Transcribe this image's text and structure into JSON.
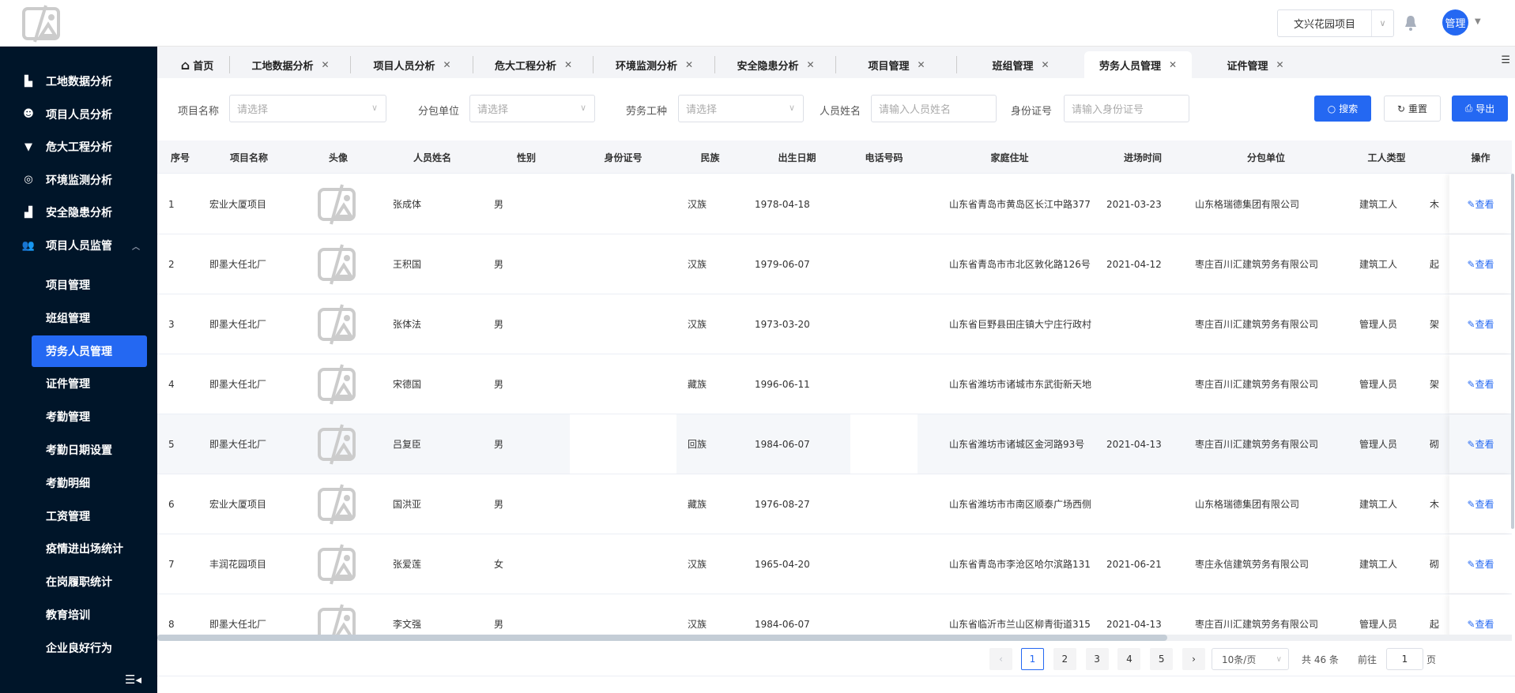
{
  "header": {
    "project_select": "文兴花园项目",
    "avatar_label": "管理"
  },
  "sidebar": {
    "items": [
      {
        "label": "工地数据分析",
        "icon": "building-icon"
      },
      {
        "label": "项目人员分析",
        "icon": "person-icon"
      },
      {
        "label": "危大工程分析",
        "icon": "filter-icon"
      },
      {
        "label": "环境监测分析",
        "icon": "globe-icon"
      },
      {
        "label": "安全隐患分析",
        "icon": "bar-chart-icon"
      },
      {
        "label": "项目人员监管",
        "icon": "users-icon"
      }
    ],
    "sub_items": [
      "项目管理",
      "班组管理",
      "劳务人员管理",
      "证件管理",
      "考勤管理",
      "考勤日期设置",
      "考勤明细",
      "工资管理",
      "疫情进出场统计",
      "在岗履职统计",
      "教育培训",
      "企业良好行为"
    ],
    "active_sub": "劳务人员管理"
  },
  "tabs": [
    {
      "label": "首页",
      "closable": false
    },
    {
      "label": "工地数据分析"
    },
    {
      "label": "项目人员分析"
    },
    {
      "label": "危大工程分析"
    },
    {
      "label": "环境监测分析"
    },
    {
      "label": "安全隐患分析"
    },
    {
      "label": "项目管理"
    },
    {
      "label": "班组管理"
    },
    {
      "label": "劳务人员管理",
      "active": true
    },
    {
      "label": "证件管理"
    }
  ],
  "filters": {
    "project_label": "项目名称",
    "project_placeholder": "请选择",
    "subcontractor_label": "分包单位",
    "subcontractor_placeholder": "请选择",
    "worktype_label": "劳务工种",
    "worktype_placeholder": "请选择",
    "name_label": "人员姓名",
    "name_placeholder": "请输入人员姓名",
    "id_label": "身份证号",
    "id_placeholder": "请输入身份证号",
    "search_button": "搜索",
    "reset_button": "重置",
    "export_button": "导出"
  },
  "table": {
    "columns": [
      "序号",
      "项目名称",
      "头像",
      "人员姓名",
      "性别",
      "身份证号",
      "民族",
      "出生日期",
      "电话号码",
      "家庭住址",
      "进场时间",
      "分包单位",
      "工人类型",
      "",
      "操作"
    ],
    "action_label": "查看",
    "rows": [
      {
        "seq": "1",
        "project": "宏业大厦项目",
        "name": "张成体",
        "gender": "男",
        "ethnic": "汉族",
        "birth": "1978-04-18",
        "address": "山东省青岛市黄岛区长江中路377",
        "entry": "2021-03-23",
        "sub": "山东格瑞德集团有限公司",
        "type": "建筑工人",
        "trade": "木"
      },
      {
        "seq": "2",
        "project": "即墨大任北厂",
        "name": "王积国",
        "gender": "男",
        "ethnic": "汉族",
        "birth": "1979-06-07",
        "address": "山东省青岛市市北区敦化路126号",
        "entry": "2021-04-12",
        "sub": "枣庄百川汇建筑劳务有限公司",
        "type": "建筑工人",
        "trade": "起"
      },
      {
        "seq": "3",
        "project": "即墨大任北厂",
        "name": "张体法",
        "gender": "男",
        "ethnic": "汉族",
        "birth": "1973-03-20",
        "address": "山东省巨野县田庄镇大宁庄行政村",
        "entry": "",
        "sub": "枣庄百川汇建筑劳务有限公司",
        "type": "管理人员",
        "trade": "架"
      },
      {
        "seq": "4",
        "project": "即墨大任北厂",
        "name": "宋德国",
        "gender": "男",
        "ethnic": "藏族",
        "birth": "1996-06-11",
        "address": "山东省潍坊市诸城市东武街新天地",
        "entry": "",
        "sub": "枣庄百川汇建筑劳务有限公司",
        "type": "管理人员",
        "trade": "架"
      },
      {
        "seq": "5",
        "project": "即墨大任北厂",
        "name": "吕复臣",
        "gender": "男",
        "ethnic": "回族",
        "birth": "1984-06-07",
        "address": "山东省潍坊市诸城区金河路93号",
        "entry": "2021-04-13",
        "sub": "枣庄百川汇建筑劳务有限公司",
        "type": "管理人员",
        "trade": "砌"
      },
      {
        "seq": "6",
        "project": "宏业大厦项目",
        "name": "国洪亚",
        "gender": "男",
        "ethnic": "藏族",
        "birth": "1976-08-27",
        "address": "山东省潍坊市市南区顺泰广场西侧",
        "entry": "",
        "sub": "山东格瑞德集团有限公司",
        "type": "建筑工人",
        "trade": "木"
      },
      {
        "seq": "7",
        "project": "丰润花园项目",
        "name": "张爱莲",
        "gender": "女",
        "ethnic": "汉族",
        "birth": "1965-04-20",
        "address": "山东省青岛市李沧区哈尔滨路131",
        "entry": "2021-06-21",
        "sub": "枣庄永信建筑劳务有限公司",
        "type": "建筑工人",
        "trade": "砌"
      },
      {
        "seq": "8",
        "project": "即墨大任北厂",
        "name": "李文强",
        "gender": "男",
        "ethnic": "汉族",
        "birth": "1984-06-07",
        "address": "山东省临沂市兰山区柳青街道315",
        "entry": "2021-04-13",
        "sub": "枣庄百川汇建筑劳务有限公司",
        "type": "管理人员",
        "trade": "起"
      }
    ]
  },
  "pagination": {
    "pages": [
      "1",
      "2",
      "3",
      "4",
      "5"
    ],
    "current": "1",
    "page_size": "10条/页",
    "total": "共 46 条",
    "goto_label": "前往",
    "goto_value": "1",
    "page_suffix": "页"
  },
  "colors": {
    "primary": "#2468f2",
    "sidebar": "#001529"
  }
}
